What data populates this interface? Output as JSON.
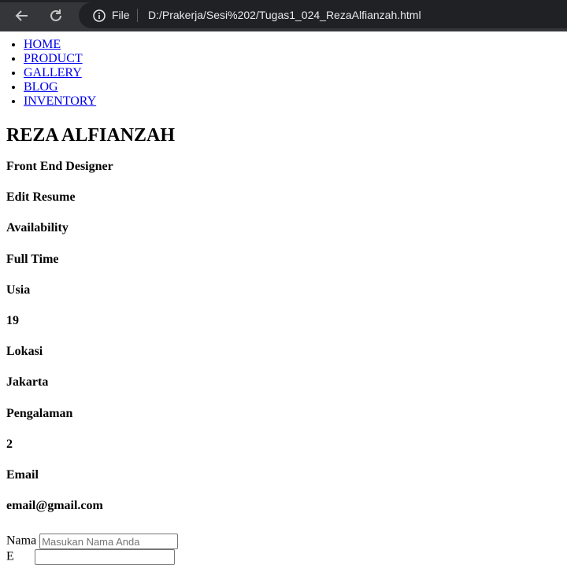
{
  "browser": {
    "file_label": "File",
    "url": "D:/Prakerja/Sesi%202/Tugas1_024_RezaAlfianzah.html"
  },
  "nav": [
    "HOME",
    "PRODUCT",
    "GALLERY",
    "BLOG",
    "INVENTORY"
  ],
  "profile": {
    "name": "REZA ALFIANZAH",
    "items": [
      "Front End Designer",
      "Edit Resume",
      "Availability",
      "Full Time",
      "Usia",
      "19",
      "Lokasi",
      "Jakarta",
      "Pengalaman",
      "2",
      "Email",
      "email@gmail.com"
    ]
  },
  "form": {
    "name_label": "Nama",
    "name_placeholder": "Masukan Nama Anda",
    "second_label": "E"
  }
}
